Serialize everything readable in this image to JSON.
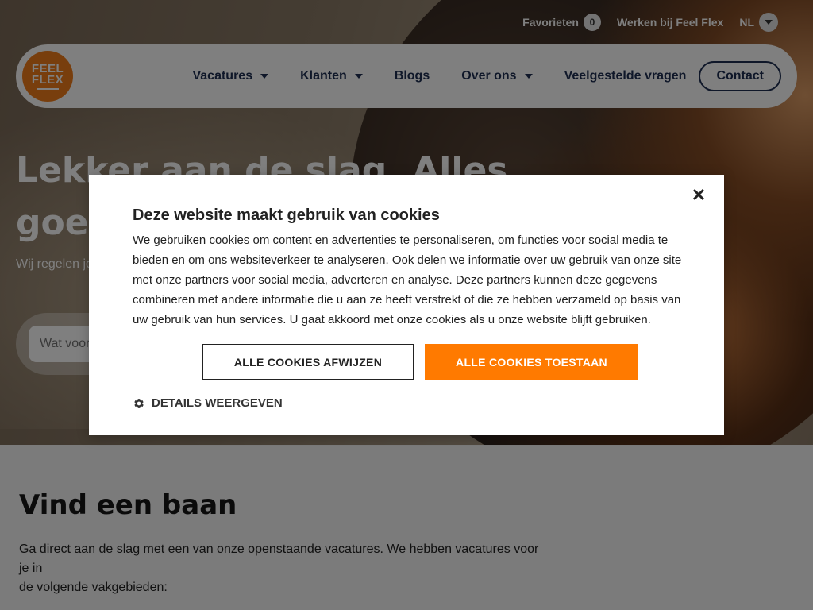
{
  "topbar": {
    "favorites_label": "Favorieten",
    "favorites_count": "0",
    "work_label": "Werken bij Feel Flex",
    "language": "NL"
  },
  "logo": {
    "line1": "FEEL",
    "line2": "FLEX"
  },
  "nav": {
    "items": [
      {
        "label": "Vacatures",
        "has_dropdown": true
      },
      {
        "label": "Klanten",
        "has_dropdown": true
      },
      {
        "label": "Blogs",
        "has_dropdown": false
      },
      {
        "label": "Over ons",
        "has_dropdown": true
      },
      {
        "label": "Veelgestelde vragen",
        "has_dropdown": false
      }
    ],
    "contact_label": "Contact"
  },
  "hero": {
    "title_line1": "Lekker aan de slag. Alles",
    "title_line2": "goed",
    "subtitle": "Wij regelen jo",
    "search_placeholder": "Wat voor"
  },
  "section": {
    "title": "Vind een baan",
    "body_line1": "Ga direct aan de slag met een van onze openstaande vacatures. We hebben vacatures voor je in",
    "body_line2": "de volgende vakgebieden:"
  },
  "cookie_dialog": {
    "title": "Deze website maakt gebruik van cookies",
    "text": "We gebruiken cookies om content en advertenties te personaliseren, om functies voor social media te bieden en om ons websiteverkeer te analyseren. Ook delen we informatie over uw gebruik van onze site met onze partners voor social media, adverteren en analyse. Deze partners kunnen deze gegevens combineren met andere informatie die u aan ze heeft verstrekt of die ze hebben verzameld op basis van uw gebruik van hun services. U gaat akkoord met onze cookies als u onze website blijft gebruiken.",
    "reject_label": "ALLE COOKIES AFWIJZEN",
    "accept_label": "ALLE COOKIES TOESTAAN",
    "details_label": "DETAILS WEERGEVEN",
    "close_icon": "close-icon",
    "details_icon": "gear-icon"
  },
  "colors": {
    "brand_orange": "#f07d1a",
    "accept_button": "#ff7a00",
    "navy": "#1e2f52"
  }
}
